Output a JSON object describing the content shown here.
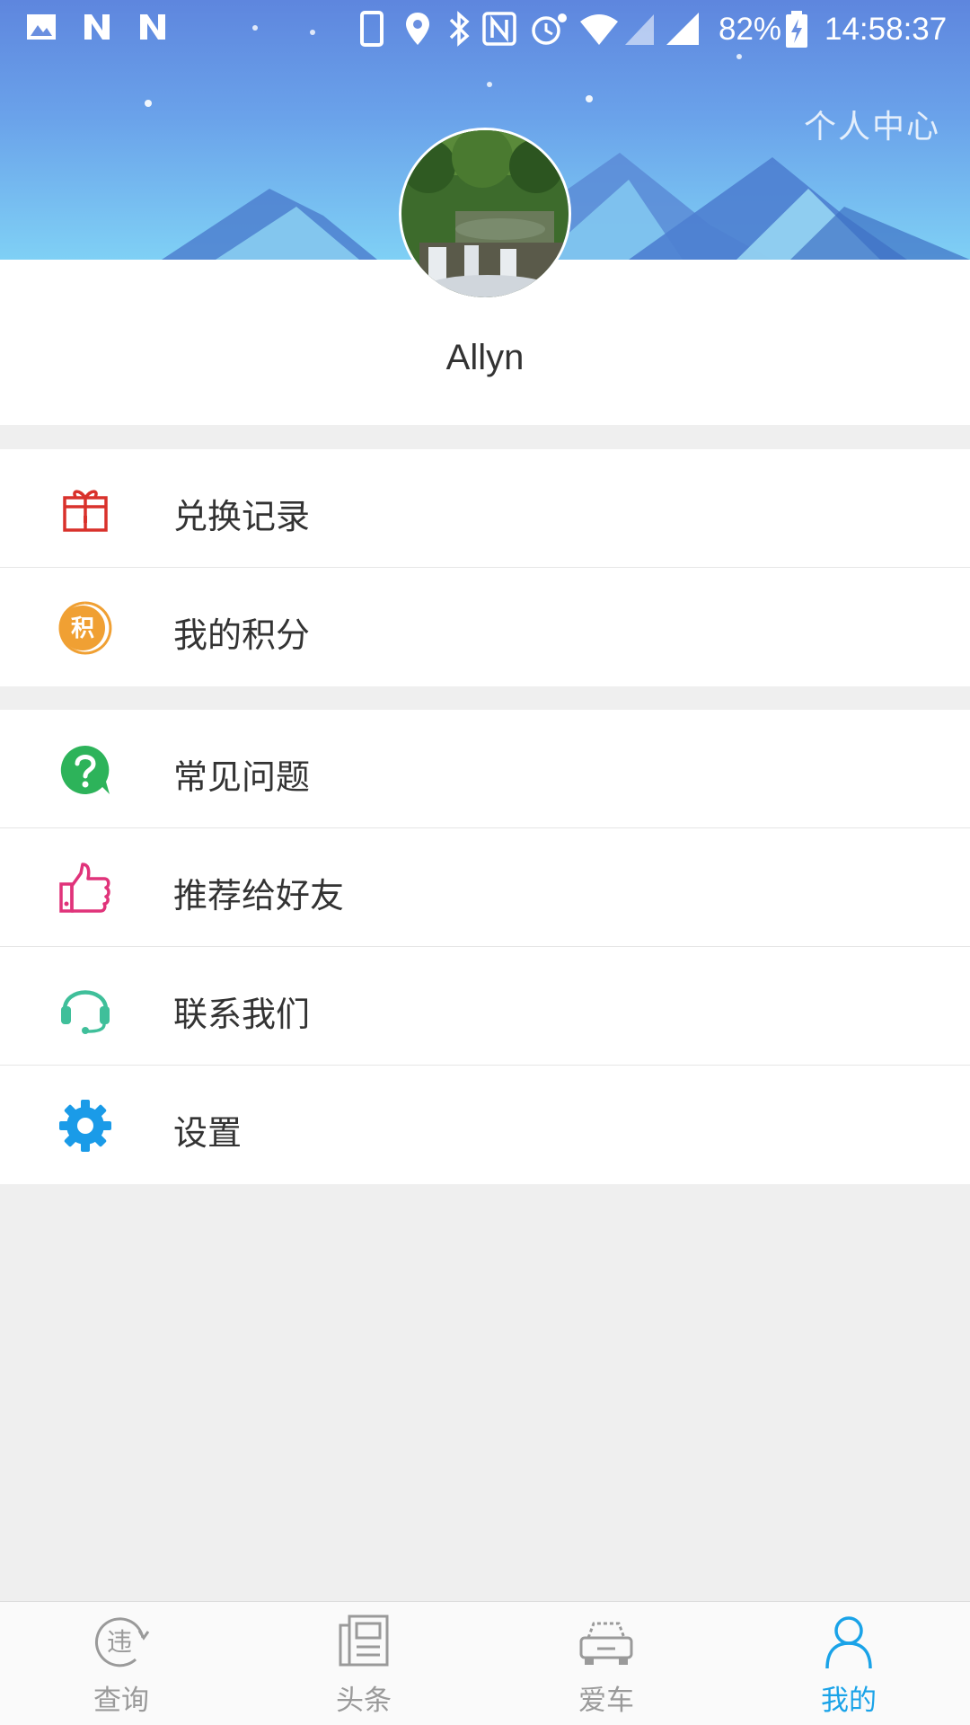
{
  "status_bar": {
    "battery_percent": "82%",
    "time": "14:58:37",
    "icons": [
      "image-icon",
      "n-notification-icon",
      "n-notification-icon",
      "phone-icon",
      "location-icon",
      "bluetooth-icon",
      "nfc-icon",
      "alarm-icon",
      "wifi-icon",
      "cell-signal-icon",
      "battery-charging-icon"
    ]
  },
  "header": {
    "title": "个人中心",
    "colors": {
      "sky_top": "#5e86de",
      "sky_bottom": "#7fd0f5"
    }
  },
  "profile": {
    "username": "Allyn",
    "avatar_icon": "landscape-photo-avatar"
  },
  "menu": {
    "group1": [
      {
        "label": "兑换记录",
        "icon": "gift-icon",
        "color": "#d9312b"
      },
      {
        "label": "我的积分",
        "icon": "points-icon",
        "color": "#f0a033"
      }
    ],
    "group2": [
      {
        "label": "常见问题",
        "icon": "question-icon",
        "color": "#2db35a"
      },
      {
        "label": "推荐给好友",
        "icon": "thumbs-up-icon",
        "color": "#e0337a"
      },
      {
        "label": "联系我们",
        "icon": "headset-icon",
        "color": "#3fbf9a"
      },
      {
        "label": "设置",
        "icon": "gear-icon",
        "color": "#1a9be8"
      }
    ],
    "points_icon_glyph": "积"
  },
  "bottom_nav": {
    "items": [
      {
        "label": "查询",
        "icon": "violation-query-icon",
        "active": false
      },
      {
        "label": "头条",
        "icon": "newspaper-icon",
        "active": false
      },
      {
        "label": "爱车",
        "icon": "car-icon",
        "active": false
      },
      {
        "label": "我的",
        "icon": "person-icon",
        "active": true
      }
    ],
    "query_icon_glyph": "违",
    "colors": {
      "active": "#1aa3e8",
      "inactive": "#9a9a9a"
    }
  }
}
